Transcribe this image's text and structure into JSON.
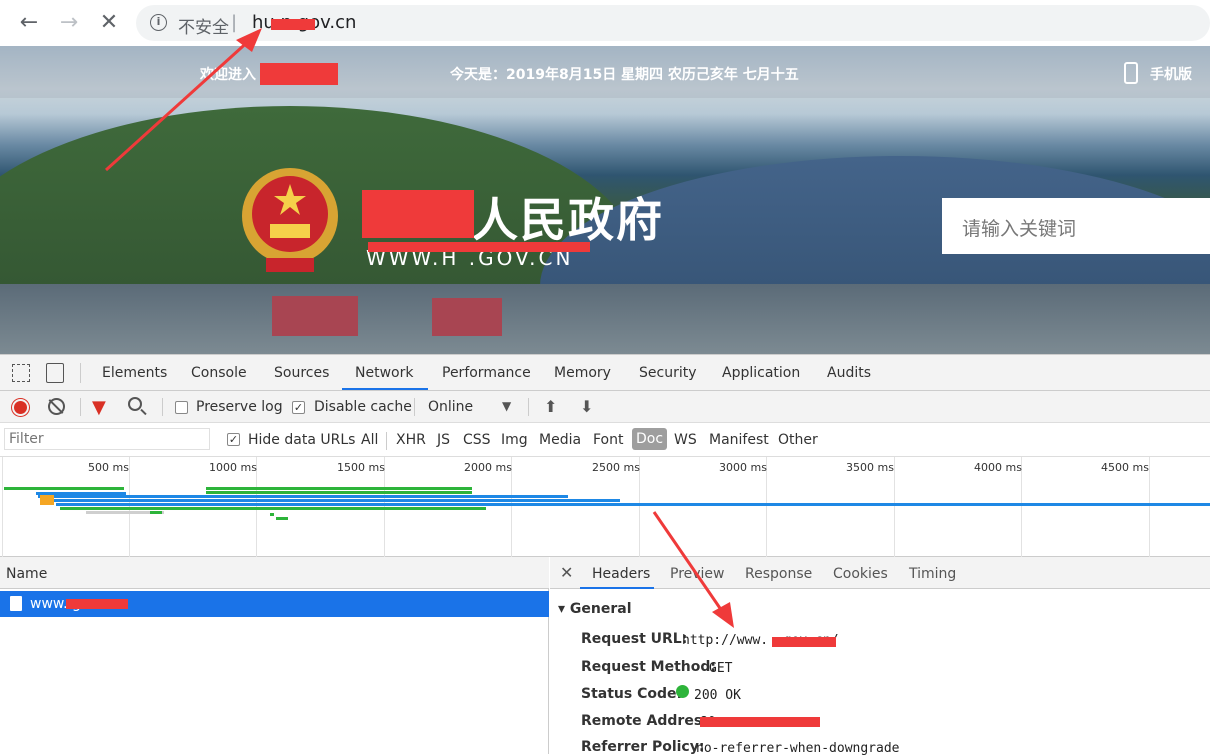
{
  "browser": {
    "security_label": "不安全",
    "separator": "|",
    "url": "hu        n.gov.cn"
  },
  "banner": {
    "welcome": "欢迎进入              人民政府网！",
    "date": "今天是：2019年8月15日 星期四 农历己亥年 七月十五",
    "mobile": "手机版",
    "site_title": "人民政府",
    "site_domain": "WWW.H          .GOV.CN",
    "search_placeholder": "请输入关键词"
  },
  "devtools": {
    "tabs": [
      "Elements",
      "Console",
      "Sources",
      "Network",
      "Performance",
      "Memory",
      "Security",
      "Application",
      "Audits"
    ],
    "active_tab": "Network",
    "toolbar": {
      "preserve_log": "Preserve log",
      "preserve_log_checked": false,
      "disable_cache": "Disable cache",
      "disable_cache_checked": true,
      "throttle": "Online"
    },
    "filter": {
      "placeholder": "Filter",
      "hide_data_urls": "Hide data URLs",
      "hide_data_urls_checked": true,
      "types": [
        "All",
        "XHR",
        "JS",
        "CSS",
        "Img",
        "Media",
        "Font",
        "Doc",
        "WS",
        "Manifest",
        "Other"
      ],
      "active_type": "Doc"
    },
    "timeline_ticks": [
      "500 ms",
      "1000 ms",
      "1500 ms",
      "2000 ms",
      "2500 ms",
      "3000 ms",
      "3500 ms",
      "4000 ms",
      "4500 ms"
    ],
    "requests": {
      "column": "Name",
      "items": [
        {
          "name": "www.            gov.cn"
        }
      ]
    },
    "detail": {
      "tabs": [
        "Headers",
        "Preview",
        "Response",
        "Cookies",
        "Timing"
      ],
      "active_tab": "Headers",
      "section": "General",
      "request_url_label": "Request URL:",
      "request_url": "http://www.          .gov.cn/",
      "method_label": "Request Method:",
      "method": "GET",
      "status_label": "Status Code:",
      "status": "200  OK",
      "remote_label": "Remote Address:",
      "remote": "              80",
      "referrer_label": "Referrer Policy:",
      "referrer": "no-referrer-when-downgrade"
    }
  },
  "colors": {
    "accent": "#1a73e8",
    "record": "#d93025",
    "status_ok": "#2db43a",
    "annotation_arrow": "#ef3a3a",
    "redaction": "#ef3a3a"
  }
}
